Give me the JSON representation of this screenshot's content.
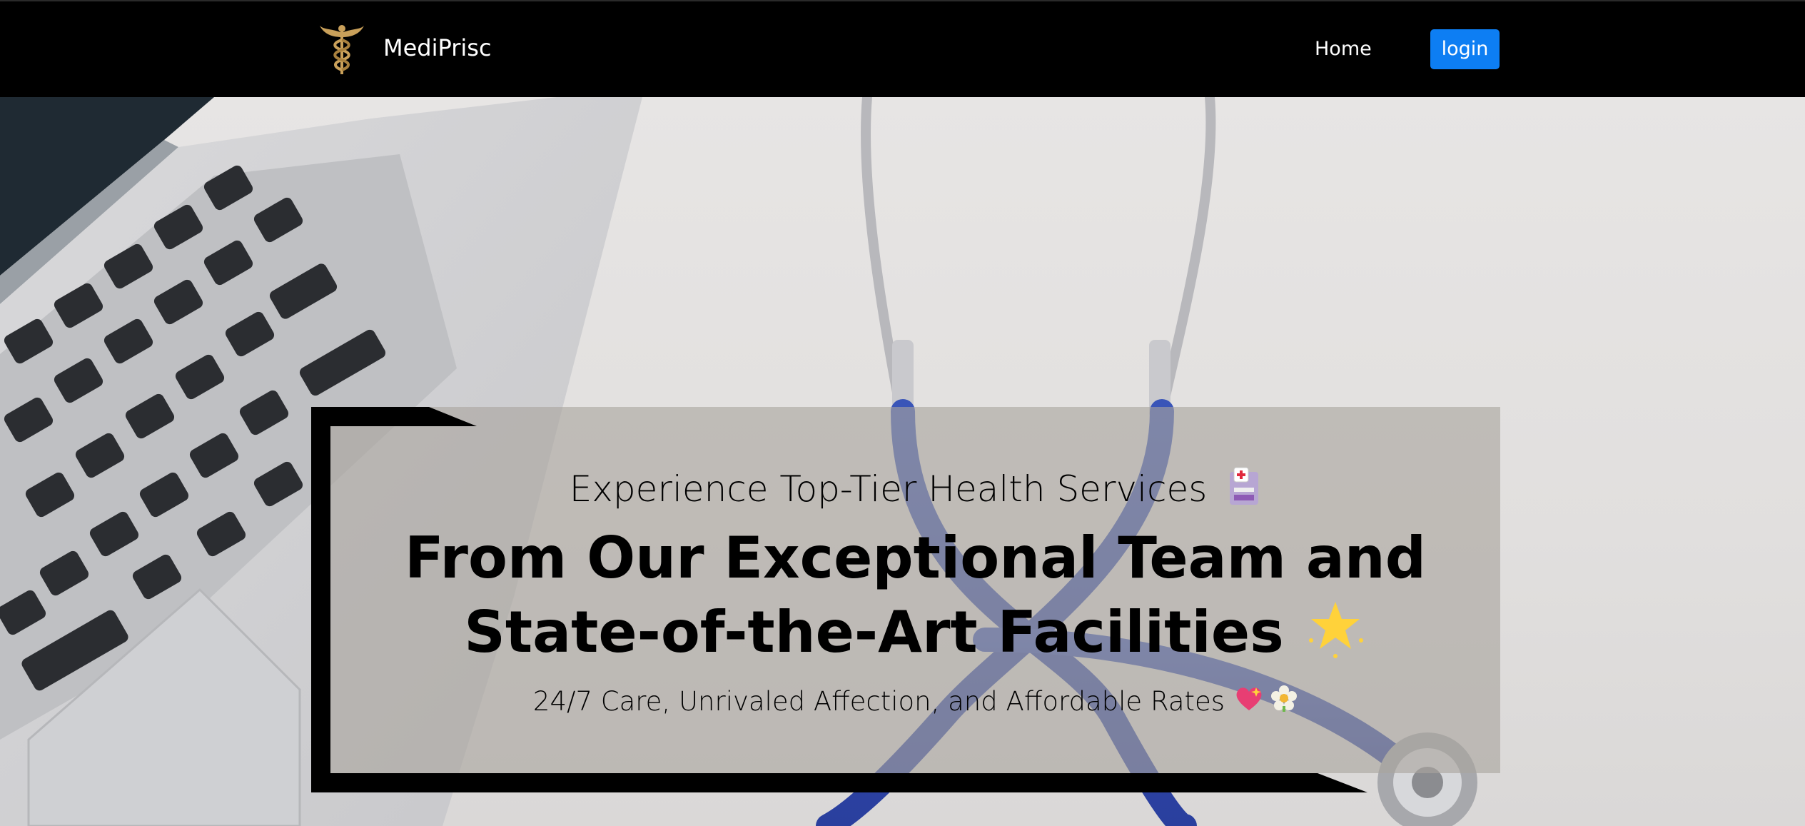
{
  "brand": {
    "name": "MediPrisc",
    "logo_icon": "caduceus-icon",
    "logo_color": "#c9a05a"
  },
  "nav": {
    "home_label": "Home",
    "login_label": "login",
    "login_color": "#0d7ef3"
  },
  "hero": {
    "background_image": "laptop-and-stethoscope-photo",
    "subtitle": "Experience Top-Tier Health Services",
    "subtitle_emoji": "🏥",
    "title_line1": "From Our Exceptional Team and",
    "title_line2": "State-of-the-Art Facilities",
    "title_emoji": "🌟",
    "tagline": "24/7 Care, Unrivaled Affection, and Affordable Rates",
    "tagline_emoji_1": "💖",
    "tagline_emoji_2": "🌼"
  }
}
